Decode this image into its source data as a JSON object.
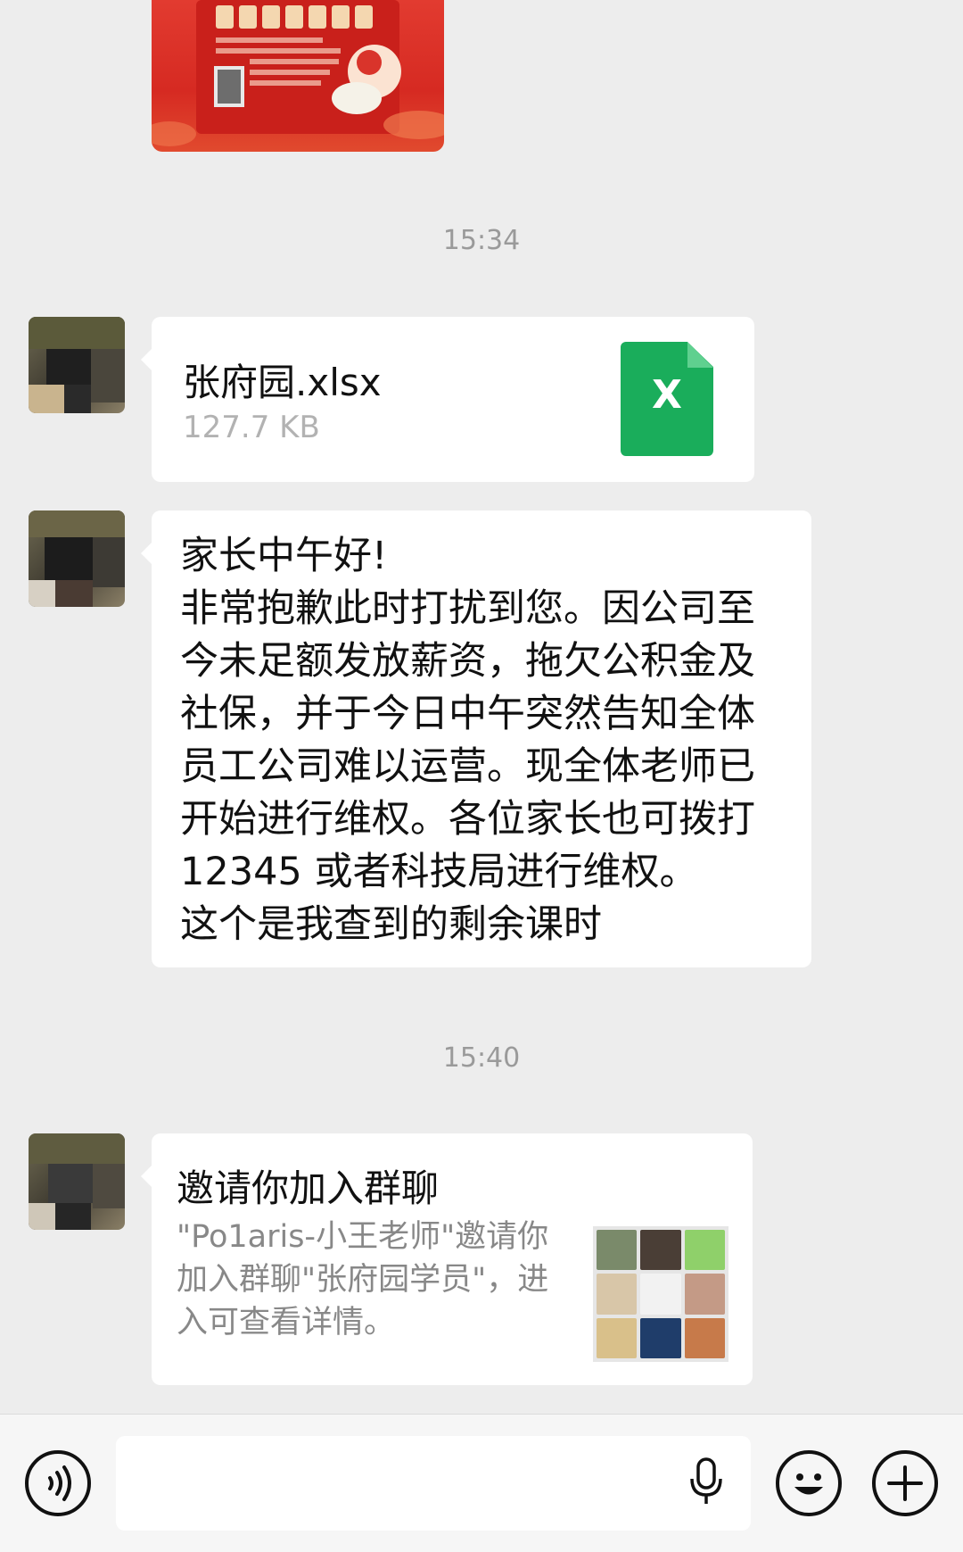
{
  "timestamps": [
    "15:34",
    "15:40"
  ],
  "file_message": {
    "name": "张府园.xlsx",
    "size": "127.7 KB",
    "icon": "excel-file-icon",
    "icon_letter": "X",
    "icon_color": "#1aad5b"
  },
  "text_message": {
    "lines": [
      "家长中午好!",
      "非常抱歉此时打扰到您。因公司至",
      "今未足额发放薪资，拖欠公积金及",
      "社保，并于今日中午突然告知全体",
      "员工公司难以运营。现全体老师已",
      "开始进行维权。各位家长也可拨打",
      "12345 或者科技局进行维权。",
      "这个是我查到的剩余课时"
    ]
  },
  "invite_message": {
    "title": "邀请你加入群聊",
    "desc_lines": [
      "\"Po1aris-小王老师\"邀请你",
      "加入群聊\"张府园学员\"，进",
      "入可查看详情。"
    ]
  },
  "input_bar": {
    "voice_icon": "voice-icon",
    "mic_icon": "microphone-icon",
    "emoji_icon": "emoji-icon",
    "plus_icon": "plus-icon",
    "value": ""
  },
  "colors": {
    "background": "#ededed",
    "bubble": "#ffffff",
    "timestamp": "#9a9a9a",
    "secondary_text": "#888888"
  }
}
